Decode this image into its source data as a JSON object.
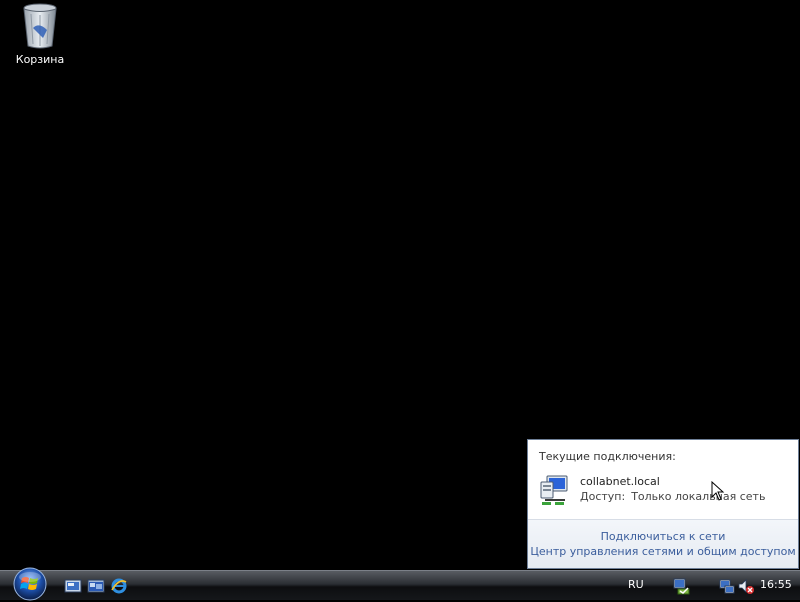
{
  "desktop": {
    "icons": [
      {
        "label": "Корзина",
        "icon": "recycle-bin-icon"
      }
    ]
  },
  "network_flyout": {
    "heading": "Текущие подключения:",
    "connection": {
      "name": "collabnet.local",
      "access_label": "Доступ:",
      "access_value": "Только локальная сеть",
      "icon": "network-computer-icon"
    },
    "links": {
      "connect": "Подключиться к сети",
      "network_center": "Центр управления сетями и общим доступом"
    }
  },
  "taskbar": {
    "start_icon": "windows-start-orb-icon",
    "quick_launch": [
      "show-desktop-icon",
      "switch-windows-icon",
      "internet-explorer-icon"
    ],
    "language": "RU",
    "tray_icons": [
      "security-center-icon",
      "network-tray-icon",
      "volume-muted-icon"
    ],
    "clock": "16:55"
  }
}
